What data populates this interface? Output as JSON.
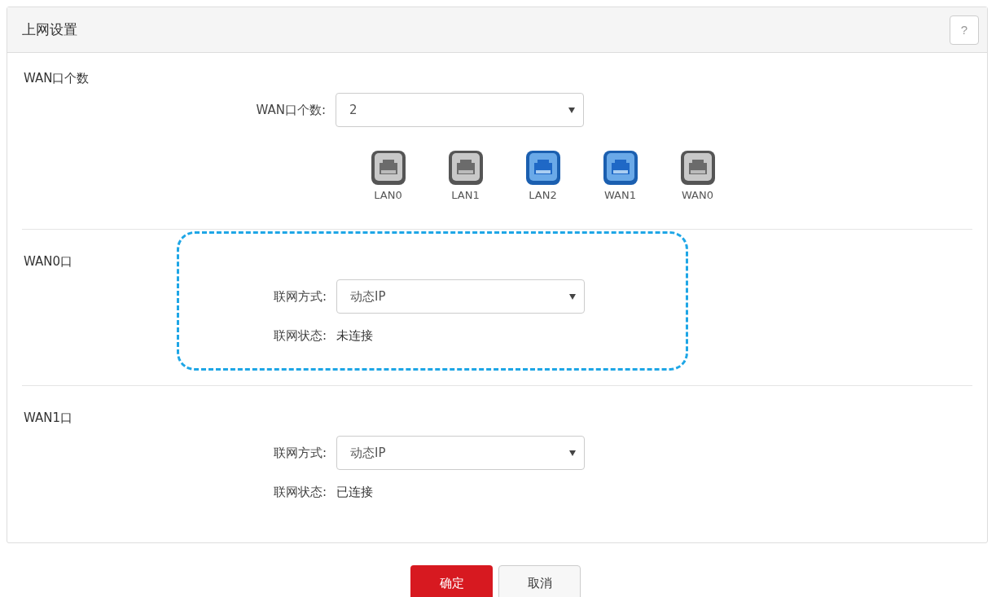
{
  "panel": {
    "title": "上网设置",
    "help_button": "?"
  },
  "wan_count": {
    "heading": "WAN口个数",
    "field_label": "WAN口个数:",
    "value": "2",
    "ports": [
      {
        "label": "LAN0",
        "active": false
      },
      {
        "label": "LAN1",
        "active": false
      },
      {
        "label": "LAN2",
        "active": true
      },
      {
        "label": "WAN1",
        "active": true
      },
      {
        "label": "WAN0",
        "active": false
      }
    ]
  },
  "wan_sections": [
    {
      "heading": "WAN0口",
      "highlighted": true,
      "mode_label": "联网方式:",
      "mode_value": "动态IP",
      "status_label": "联网状态:",
      "status_value": "未连接"
    },
    {
      "heading": "WAN1口",
      "highlighted": false,
      "mode_label": "联网方式:",
      "mode_value": "动态IP",
      "status_label": "联网状态:",
      "status_value": "已连接"
    }
  ],
  "buttons": {
    "ok": "确定",
    "cancel": "取消"
  }
}
